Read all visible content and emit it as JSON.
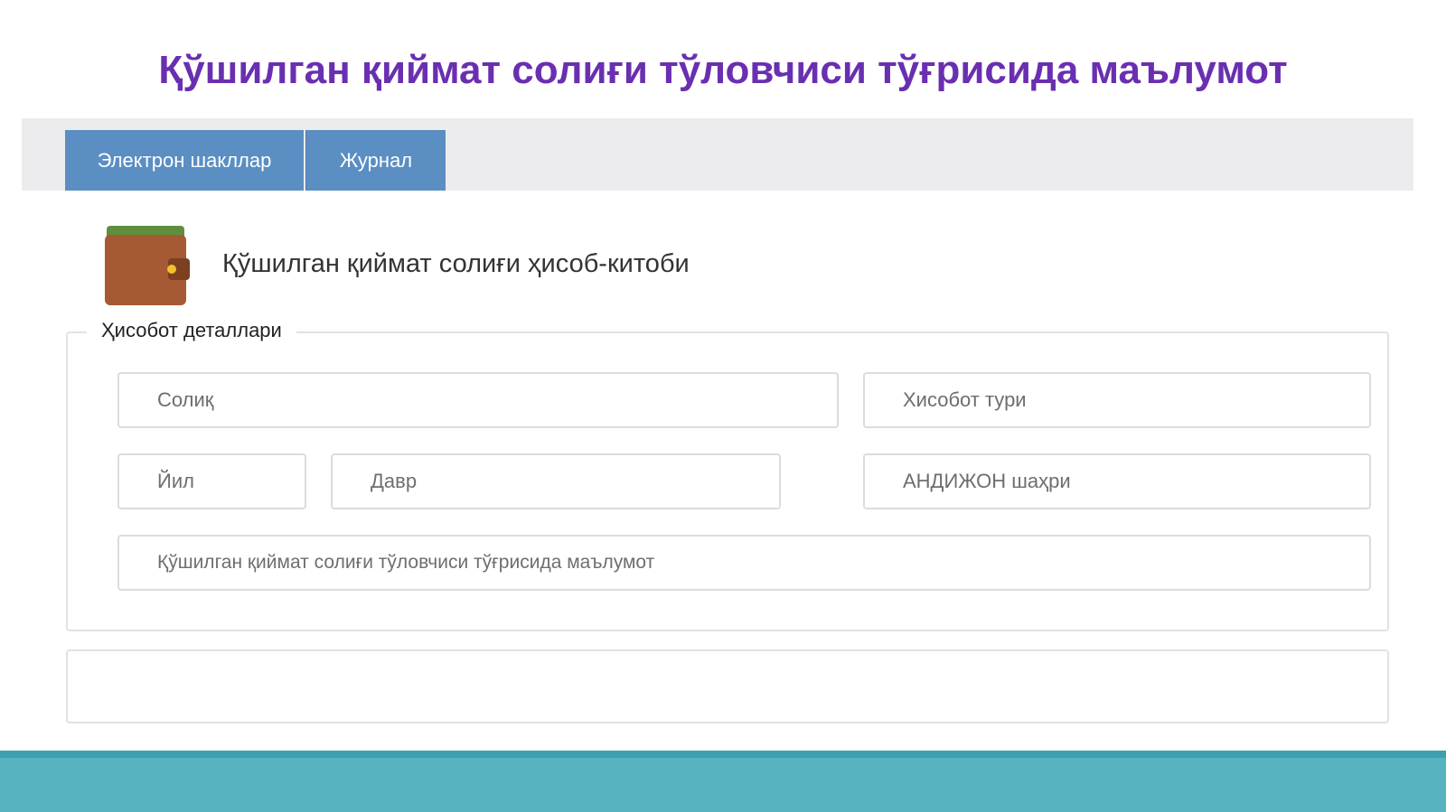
{
  "page": {
    "title": "Қўшилган қиймат солиғи тўловчиси тўғрисида маълумот"
  },
  "tabs": [
    {
      "label": "Электрон шакллар"
    },
    {
      "label": "Журнал"
    }
  ],
  "section": {
    "icon": "wallet-icon",
    "title": "Қўшилган қиймат солиғи ҳисоб-китоби"
  },
  "report_details": {
    "legend": "Ҳисобот деталлари",
    "fields": {
      "solik": "Солиқ",
      "hisobot_turi": "Хисобот тури",
      "yil": "Йил",
      "davr": "Давр",
      "shahar": "АНДИЖОН шаҳри",
      "info": "Қўшилган қиймат солиғи тўловчиси тўғрисида маълумот"
    }
  },
  "colors": {
    "title": "#6a2fb0",
    "tab_bg": "#5b8ec3",
    "footer": "#57b3bf"
  }
}
